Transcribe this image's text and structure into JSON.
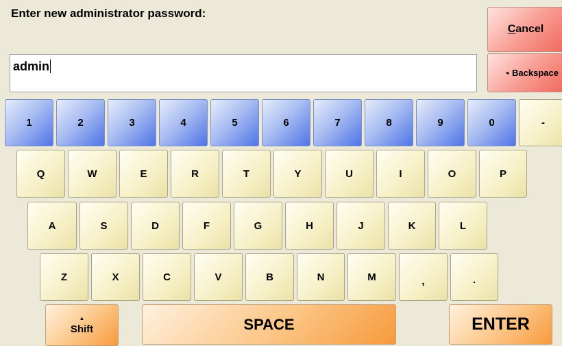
{
  "dialog": {
    "prompt": "Enter new administrator password:",
    "input_value": "admin"
  },
  "actions": {
    "cancel_underlined": "C",
    "cancel_rest": "ancel",
    "backspace_arrow": "◂",
    "backspace_label": "Backspace"
  },
  "keyboard": {
    "numbers": [
      "1",
      "2",
      "3",
      "4",
      "5",
      "6",
      "7",
      "8",
      "9",
      "0",
      "-"
    ],
    "row_q": [
      "Q",
      "W",
      "E",
      "R",
      "T",
      "Y",
      "U",
      "I",
      "O",
      "P"
    ],
    "row_a": [
      "A",
      "S",
      "D",
      "F",
      "G",
      "H",
      "J",
      "K",
      "L"
    ],
    "row_z": [
      "Z",
      "X",
      "C",
      "V",
      "B",
      "N",
      "M",
      ",",
      "."
    ],
    "shift_arrow": "▲",
    "shift_label": "Shift",
    "space_label": "SPACE",
    "enter_label": "ENTER"
  },
  "colors": {
    "background": "#ece9d8",
    "number_key": "#4f74e6",
    "letter_key": "#f6f0c6",
    "action_key_red": "#f06a5e",
    "action_key_orange": "#f79a3c"
  }
}
